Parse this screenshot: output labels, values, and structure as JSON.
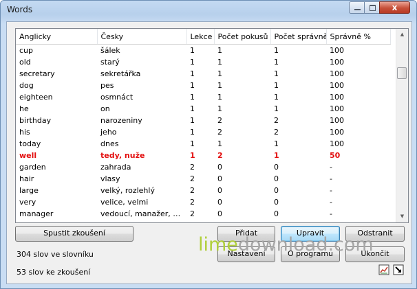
{
  "window": {
    "title": "Words",
    "close_glyph": "x"
  },
  "table": {
    "headers": [
      "Anglicky",
      "Česky",
      "Lekce",
      "Počet pokusů",
      "Počet správně",
      "Správně %"
    ],
    "rows": [
      [
        "cup",
        "šálek",
        "1",
        "1",
        "1",
        "100"
      ],
      [
        "old",
        "starý",
        "1",
        "1",
        "1",
        "100"
      ],
      [
        "secretary",
        "sekretářka",
        "1",
        "1",
        "1",
        "100"
      ],
      [
        "dog",
        "pes",
        "1",
        "1",
        "1",
        "100"
      ],
      [
        "eighteen",
        "osmnáct",
        "1",
        "1",
        "1",
        "100"
      ],
      [
        "he",
        "on",
        "1",
        "1",
        "1",
        "100"
      ],
      [
        "birthday",
        "narozeniny",
        "1",
        "2",
        "2",
        "100"
      ],
      [
        "his",
        "jeho",
        "1",
        "2",
        "2",
        "100"
      ],
      [
        "today",
        "dnes",
        "1",
        "1",
        "1",
        "100"
      ],
      [
        "well",
        "tedy, nuže",
        "1",
        "2",
        "1",
        "50"
      ],
      [
        "garden",
        "zahrada",
        "2",
        "0",
        "0",
        "-"
      ],
      [
        "hair",
        "vlasy",
        "2",
        "0",
        "0",
        "-"
      ],
      [
        "large",
        "velký, rozlehlý",
        "2",
        "0",
        "0",
        "-"
      ],
      [
        "very",
        "velice, velmi",
        "2",
        "0",
        "0",
        "-"
      ],
      [
        "manager",
        "vedoucí, manažer, ma...",
        "2",
        "0",
        "0",
        "-"
      ]
    ],
    "highlighted_row": 9,
    "highlight_color": "#e30e0e"
  },
  "buttons": {
    "start_test": "Spustit zkoušení",
    "add": "Přidat",
    "edit": "Upravit",
    "remove": "Odstranit",
    "settings": "Nastavení",
    "about": "O programu",
    "quit": "Ukončit"
  },
  "status": {
    "dictionary_count": "304 slov ve slovníku",
    "test_count": "53 slov ke zkoušení"
  },
  "watermark": {
    "part1": "lime",
    "part2": "download.com"
  },
  "icons": [
    "chart-icon",
    "resize-arrow-icon"
  ]
}
